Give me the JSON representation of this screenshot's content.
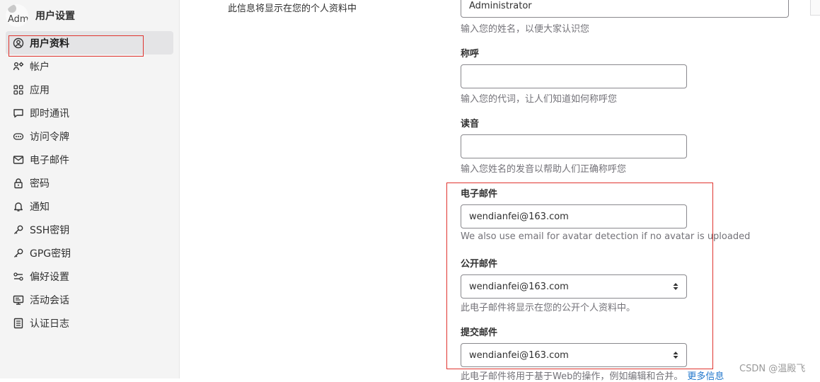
{
  "sidebar": {
    "avatar_alt": "Adm",
    "title": "用户设置",
    "items": [
      {
        "label": "用户资料",
        "icon": "user-profile-icon",
        "active": true
      },
      {
        "label": "帐户",
        "icon": "account-gear-icon"
      },
      {
        "label": "应用",
        "icon": "applications-grid-icon"
      },
      {
        "label": "即时通讯",
        "icon": "chat-bubble-icon"
      },
      {
        "label": "访问令牌",
        "icon": "token-dots-icon"
      },
      {
        "label": "电子邮件",
        "icon": "mail-icon"
      },
      {
        "label": "密码",
        "icon": "lock-icon"
      },
      {
        "label": "通知",
        "icon": "bell-icon"
      },
      {
        "label": "SSH密钥",
        "icon": "key-icon"
      },
      {
        "label": "GPG密钥",
        "icon": "key-icon"
      },
      {
        "label": "偏好设置",
        "icon": "preferences-icon"
      },
      {
        "label": "活动会话",
        "icon": "monitor-icon"
      },
      {
        "label": "认证日志",
        "icon": "log-list-icon"
      }
    ]
  },
  "main": {
    "intro": "此信息将显示在您的个人资料中",
    "name": {
      "value": "Administrator",
      "help": "输入您的姓名，以便大家认识您"
    },
    "pronouns": {
      "label": "称呼",
      "value": "",
      "help": "输入您的代词，让人们知道如何称呼您"
    },
    "pronunciation": {
      "label": "读音",
      "value": "",
      "help": "输入您姓名的发音以帮助人们正确称呼您"
    },
    "email": {
      "label": "电子邮件",
      "value": "wendianfei@163.com",
      "help": "We also use email for avatar detection if no avatar is uploaded"
    },
    "public_email": {
      "label": "公开邮件",
      "value": "wendianfei@163.com",
      "help": "此电子邮件将显示在您的公开个人资料中。"
    },
    "commit_email": {
      "label": "提交邮件",
      "value": "wendianfei@163.com",
      "help": "此电子邮件将用于基于Web的操作，例如编辑和合并。",
      "more_link": "更多信息"
    }
  },
  "watermark": "CSDN @温殿飞",
  "colors": {
    "highlight": "#e0342f",
    "link": "#1f75cb",
    "sidebar_bg": "#f4f4f4"
  }
}
